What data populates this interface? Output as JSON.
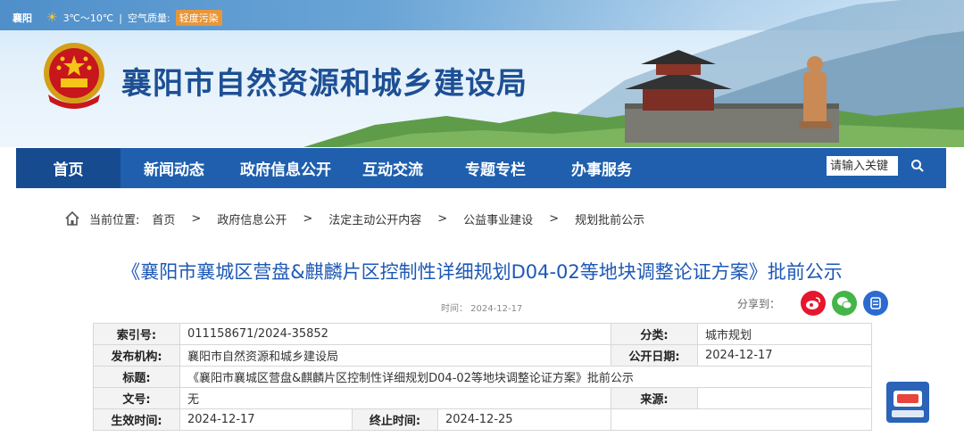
{
  "topbar": {
    "city": "襄阳",
    "weather_icon": "sun-cloud-icon",
    "temperature": "3℃～10℃",
    "separator": "|",
    "air_label": "空气质量:",
    "air_quality": "轻度污染"
  },
  "site": {
    "title": "襄阳市自然资源和城乡建设局"
  },
  "nav": {
    "items": [
      {
        "label": "首页"
      },
      {
        "label": "新闻动态"
      },
      {
        "label": "政府信息公开"
      },
      {
        "label": "互动交流"
      },
      {
        "label": "专题专栏"
      },
      {
        "label": "办事服务"
      }
    ],
    "search_placeholder": "请输入关键"
  },
  "breadcrumb": {
    "label": "当前位置:",
    "items": [
      "首页",
      "政府信息公开",
      "法定主动公开内容",
      "公益事业建设",
      "规划批前公示"
    ],
    "separator": ">"
  },
  "article": {
    "title": "《襄阳市襄城区营盘&麒麟片区控制性详细规划D04-02等地块调整论证方案》批前公示",
    "time": "时间：  2024-12-17",
    "share_label": "分享到："
  },
  "info": {
    "index_label": "索引号:",
    "index_value": "011158671/2024-35852",
    "category_label": "分类:",
    "category_value": "城市规划",
    "publisher_label": "发布机构:",
    "publisher_value": "襄阳市自然资源和城乡建设局",
    "date_label": "公开日期:",
    "date_value": "2024-12-17",
    "title_label": "标题:",
    "title_value": "《襄阳市襄城区营盘&麒麟片区控制性详细规划D04-02等地块调整论证方案》批前公示",
    "docno_label": "文号:",
    "docno_value": "无",
    "source_label": "来源:",
    "source_value": "",
    "effective_label": "生效时间:",
    "effective_value": "2024-12-17",
    "end_label": "终止时间:",
    "end_value": "2024-12-25"
  },
  "colors": {
    "brand": "#1f5fae",
    "title": "#1d58b5",
    "weibo": "#e6162d",
    "wechat": "#44b549",
    "share": "#2b6bd1"
  }
}
